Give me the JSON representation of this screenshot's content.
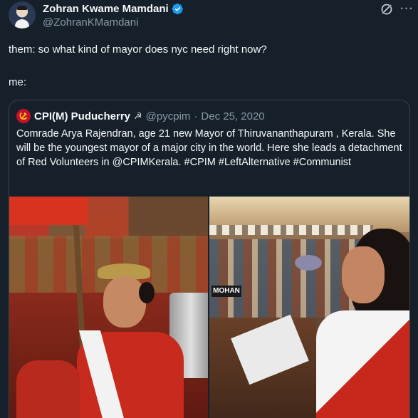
{
  "tweet": {
    "author_name": "Zohran Kwame Mamdani",
    "author_handle": "@ZohranKMamdani",
    "line1": "them: so what kind of mayor does nyc need right now?",
    "line2": "me:"
  },
  "quote": {
    "name": "CPI(M) Puducherry",
    "flag_emoji": "☭",
    "handle": "@pycpim",
    "separator": "·",
    "date": "Dec 25, 2020",
    "text": "Comrade Arya Rajendran, age 21  new Mayor of Thiruvananthapuram , Kerala. She will be the youngest mayor of a major city in the world. Here she leads a detachment of Red Volunteers in @CPIMKerala. #CPIM  #LeftAlternative #Communist",
    "photo_label": "MOHAN"
  },
  "colors": {
    "background": "#15202b",
    "text": "#f7f9f9",
    "secondary": "#8b98a5",
    "border": "#38444d",
    "verified": "#1d9bf0",
    "cpim_red": "#c8102e"
  },
  "icons": {
    "verified": "verified-badge-icon",
    "grok": "grok-icon",
    "more": "more-icon"
  }
}
